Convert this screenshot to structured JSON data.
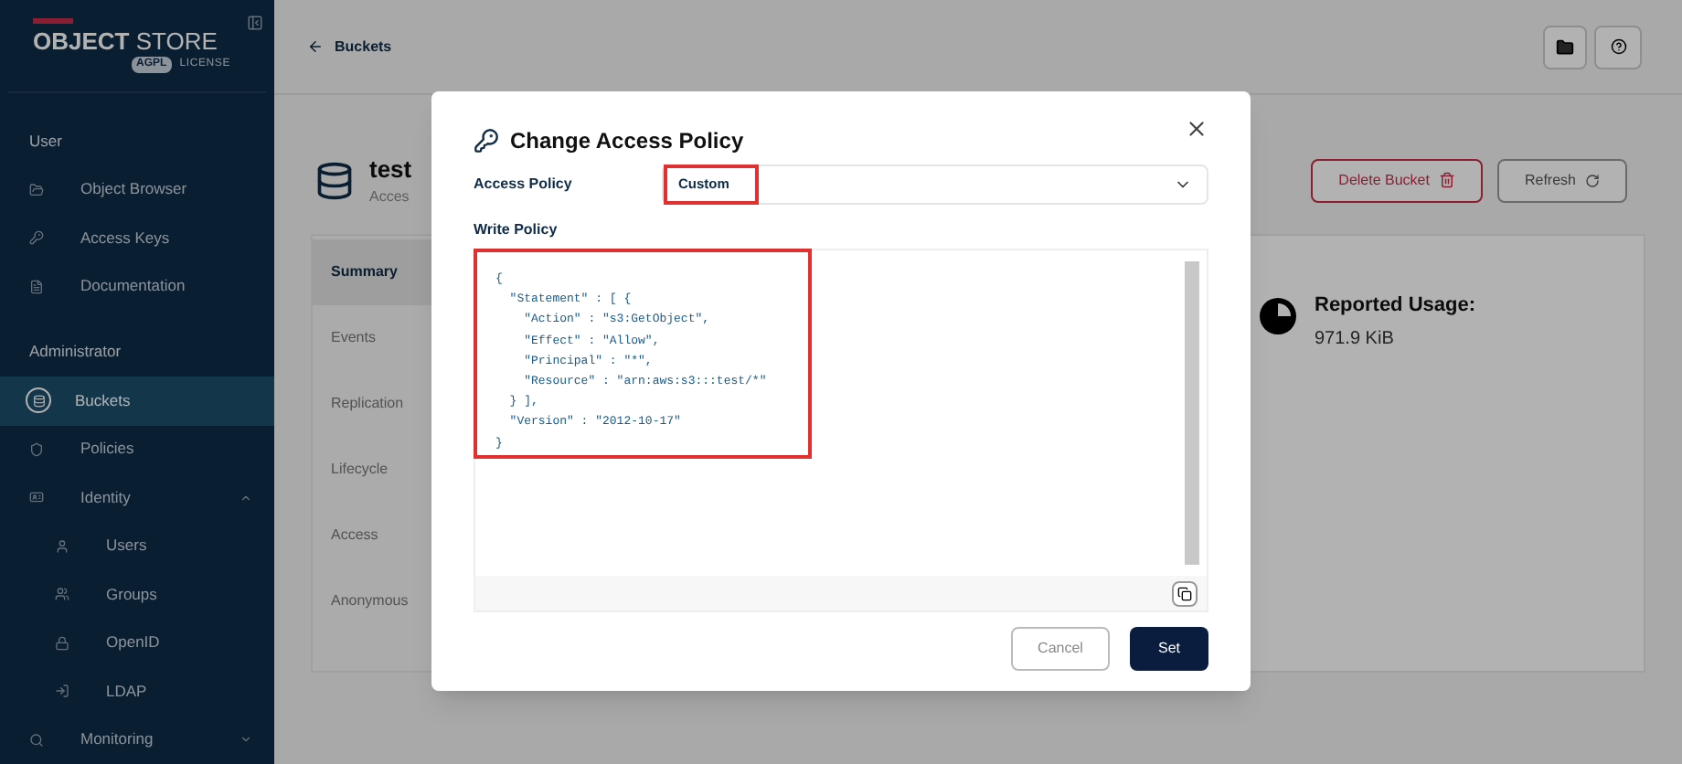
{
  "sidebar": {
    "logo": {
      "title_bold": "OBJECT",
      "title_light": "STORE",
      "badge": "AGPL",
      "license": "LICENSE"
    },
    "sections": [
      {
        "heading": "User",
        "items": [
          {
            "label": "Object Browser",
            "selected": false
          },
          {
            "label": "Access Keys",
            "selected": false
          },
          {
            "label": "Documentation",
            "selected": false
          }
        ]
      },
      {
        "heading": "Administrator",
        "items": [
          {
            "label": "Buckets",
            "selected": true
          },
          {
            "label": "Policies",
            "selected": false
          },
          {
            "label": "Identity",
            "selected": false,
            "expanded": true,
            "children": [
              {
                "label": "Users",
                "selected": false
              },
              {
                "label": "Groups",
                "selected": false
              },
              {
                "label": "OpenID",
                "selected": false
              },
              {
                "label": "LDAP",
                "selected": false
              }
            ]
          },
          {
            "label": "Monitoring",
            "selected": false,
            "expanded": false
          }
        ]
      }
    ]
  },
  "breadcrumb": {
    "back_label": "Buckets"
  },
  "bucket": {
    "name": "test",
    "subtitle": "Acces"
  },
  "actions": [
    {
      "label": "Delete Bucket",
      "kind": "danger"
    },
    {
      "label": "Refresh",
      "kind": "plain"
    }
  ],
  "tabs": [
    {
      "label": "Summary",
      "selected": true
    },
    {
      "label": "Events",
      "selected": false
    },
    {
      "label": "Replication",
      "selected": false
    },
    {
      "label": "Lifecycle",
      "selected": false
    },
    {
      "label": "Access",
      "selected": false
    },
    {
      "label": "Anonymous",
      "selected": false
    }
  ],
  "usage": {
    "label": "Reported Usage:",
    "value": "971.9 KiB"
  },
  "modal": {
    "title": "Change Access Policy",
    "access_policy": {
      "label": "Access Policy",
      "value": "Custom",
      "highlighted": true
    },
    "write_policy": {
      "label": "Write Policy",
      "highlighted": true,
      "code": [
        "{",
        "  \"Statement\" : [ {",
        "    \"Action\" : \"s3:GetObject\",",
        "    \"Effect\" : \"Allow\",",
        "    \"Principal\" : \"*\",",
        "    \"Resource\" : \"arn:aws:s3:::test/*\"",
        "  } ],",
        "  \"Version\" : \"2012-10-17\"",
        "}"
      ]
    },
    "buttons": [
      {
        "label": "Cancel",
        "kind": "secondary"
      },
      {
        "label": "Set",
        "kind": "primary"
      }
    ]
  }
}
